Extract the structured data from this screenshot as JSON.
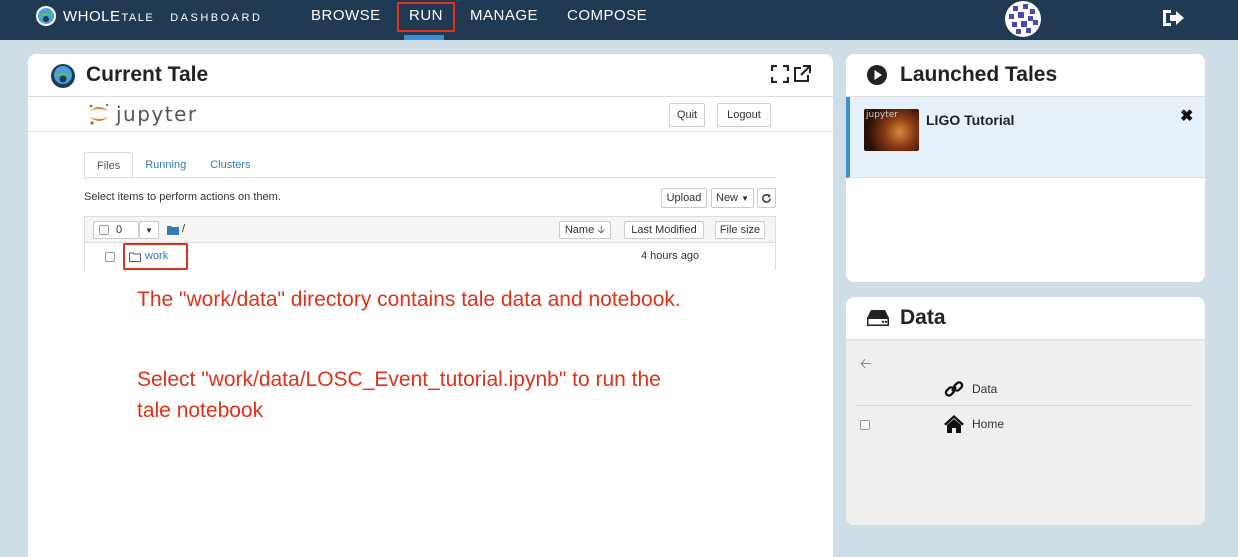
{
  "nav": {
    "brand_whole": "WHOLE",
    "brand_tale": "TALE",
    "dashboard": "DASHBOARD",
    "browse": "BROWSE",
    "run": "RUN",
    "manage": "MANAGE",
    "compose": "COMPOSE"
  },
  "current_tale": {
    "title": "Current Tale",
    "jupyter": {
      "logo_text": "jupyter",
      "quit": "Quit",
      "logout": "Logout",
      "tabs": [
        "Files",
        "Running",
        "Clusters"
      ],
      "select_message": "Select items to perform actions on them.",
      "upload": "Upload",
      "new": "New",
      "selected_count": "0",
      "breadcrumb": "/",
      "col_name": "Name",
      "col_modified": "Last Modified",
      "col_size": "File size",
      "row": {
        "name": "work",
        "modified": "4 hours ago"
      }
    },
    "annotation_1": "The \"work/data\" directory contains tale data and notebook.",
    "annotation_2": "Select \"work/data/LOSC_Event_tutorial.ipynb\" to run the tale notebook"
  },
  "launched": {
    "title": "Launched Tales",
    "items": [
      {
        "name": "LIGO Tutorial",
        "thumb_tag": "jupyter"
      }
    ]
  },
  "data_panel": {
    "title": "Data",
    "items": [
      {
        "label": "Data"
      },
      {
        "label": "Home"
      }
    ]
  },
  "colors": {
    "topbar": "#1f3a52",
    "accent": "#3b8fd9",
    "annotation": "#e2301a",
    "background": "#cfdee6"
  }
}
